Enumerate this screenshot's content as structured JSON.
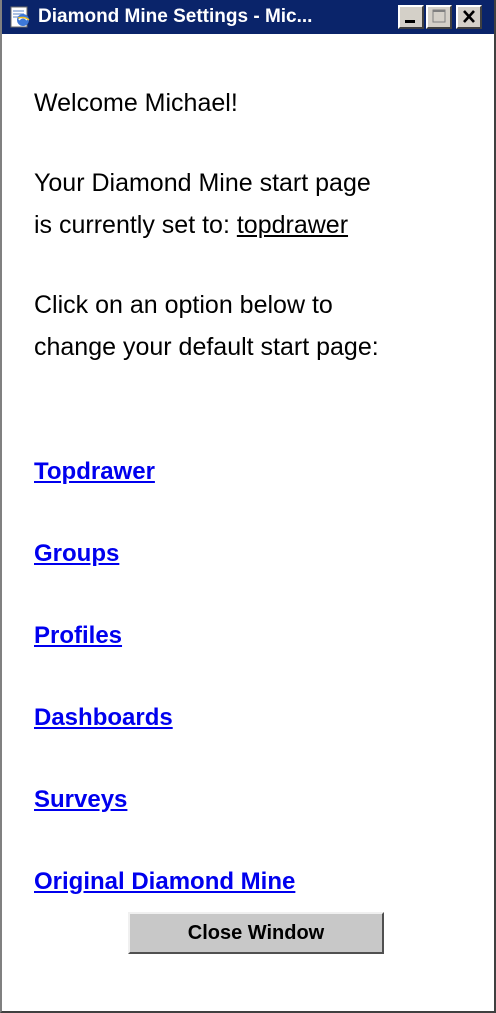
{
  "window": {
    "title": "Diamond Mine Settings - Mic...",
    "icon": "ie-page-icon",
    "controls": [
      "minimize-icon",
      "maximize-icon",
      "close-icon"
    ]
  },
  "greeting": "Welcome Michael!",
  "start_page": {
    "line1": "Your Diamond Mine start page",
    "line2_prefix": "is currently set to: ",
    "current": "topdrawer"
  },
  "instructions": {
    "line1": "Click on an option below to",
    "line2": "change your default start page:"
  },
  "options": [
    "Topdrawer",
    "Groups",
    "Profiles",
    "Dashboards",
    "Surveys",
    "Original Diamond Mine"
  ],
  "close_button": "Close Window",
  "colors": {
    "titlebar": "#0a246a",
    "link": "#0000ee",
    "button_face": "#c8c8c8"
  }
}
